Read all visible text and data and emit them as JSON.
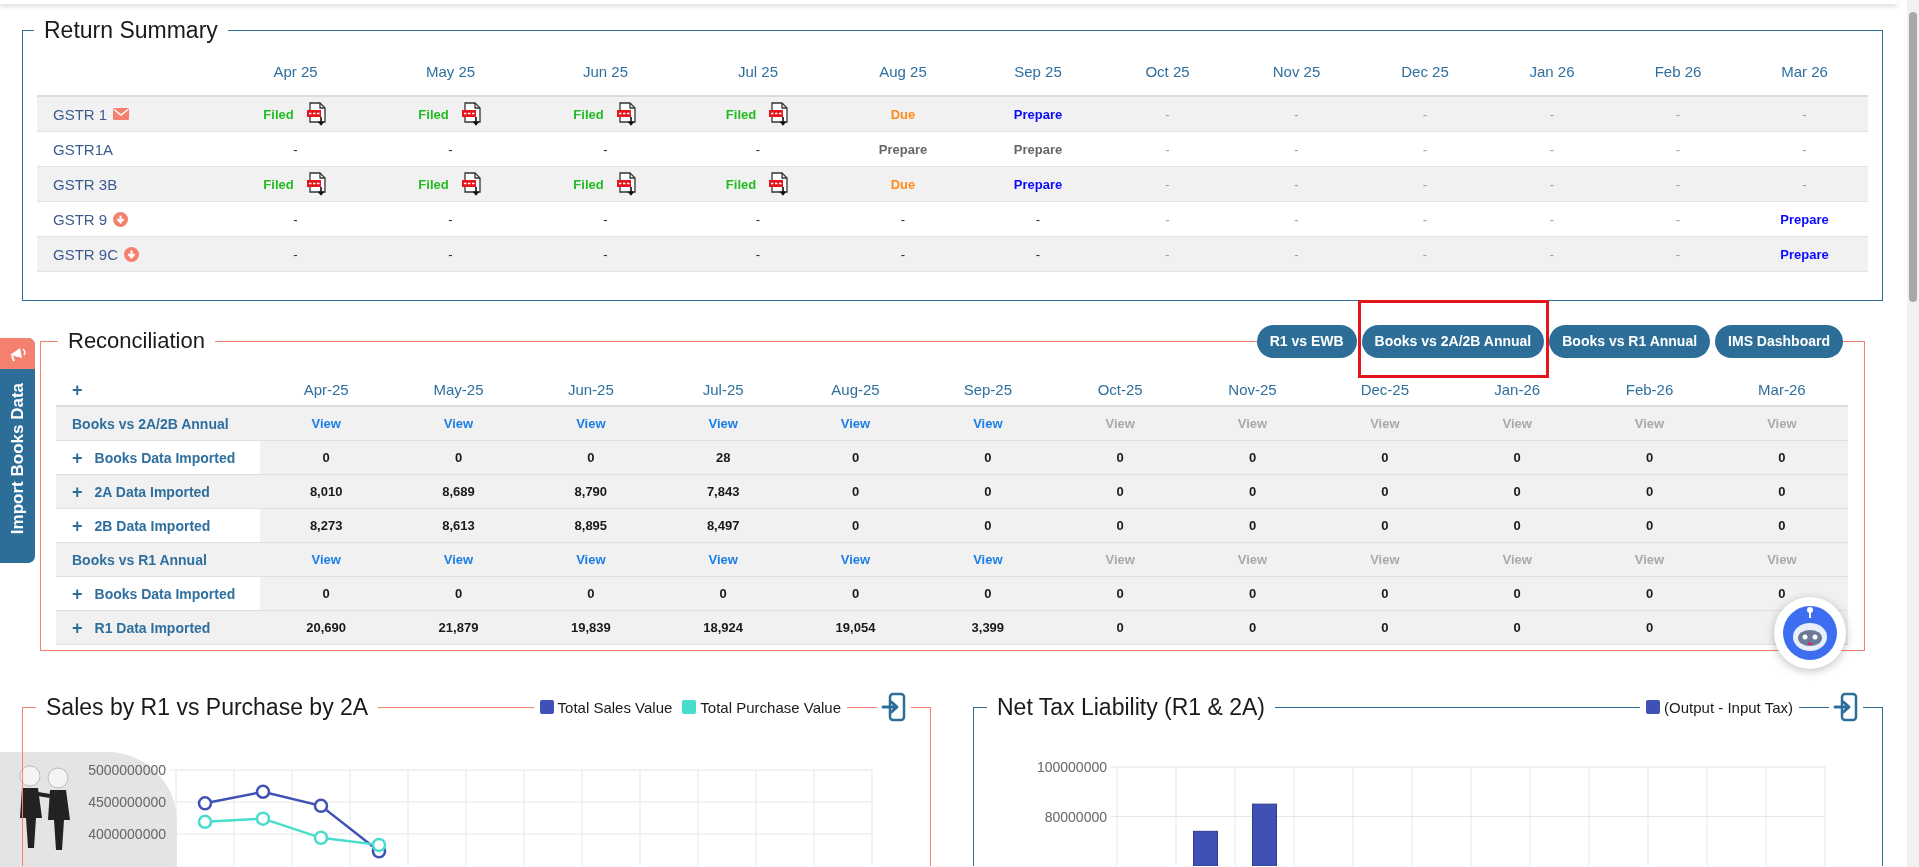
{
  "return_summary": {
    "title": "Return Summary",
    "months": [
      "Apr 25",
      "May 25",
      "Jun 25",
      "Jul 25",
      "Aug 25",
      "Sep 25",
      "Oct 25",
      "Nov 25",
      "Dec 25",
      "Jan 26",
      "Feb 26",
      "Mar 26"
    ],
    "rows": [
      {
        "name": "GSTR 1",
        "kind": "mail",
        "cells": [
          {
            "kind": "filed",
            "text": "Filed",
            "pdf": true
          },
          {
            "kind": "filed",
            "text": "Filed",
            "pdf": true
          },
          {
            "kind": "filed",
            "text": "Filed",
            "pdf": true
          },
          {
            "kind": "filed",
            "text": "Filed",
            "pdf": true
          },
          {
            "kind": "due",
            "text": "Due"
          },
          {
            "kind": "prepare",
            "text": "Prepare"
          },
          {
            "kind": "future",
            "text": "-"
          },
          {
            "kind": "future",
            "text": "-"
          },
          {
            "kind": "future",
            "text": "-"
          },
          {
            "kind": "future",
            "text": "-"
          },
          {
            "kind": "future",
            "text": "-"
          },
          {
            "kind": "future",
            "text": "-"
          }
        ]
      },
      {
        "name": "GSTR1A",
        "kind": "plain",
        "cells": [
          {
            "kind": "none",
            "text": "-"
          },
          {
            "kind": "none",
            "text": "-"
          },
          {
            "kind": "none",
            "text": "-"
          },
          {
            "kind": "none",
            "text": "-"
          },
          {
            "kind": "inactive",
            "text": "Prepare"
          },
          {
            "kind": "inactive",
            "text": "Prepare"
          },
          {
            "kind": "future",
            "text": "-"
          },
          {
            "kind": "future",
            "text": "-"
          },
          {
            "kind": "future",
            "text": "-"
          },
          {
            "kind": "future",
            "text": "-"
          },
          {
            "kind": "future",
            "text": "-"
          },
          {
            "kind": "future",
            "text": "-"
          }
        ]
      },
      {
        "name": "GSTR 3B",
        "kind": "plain",
        "cells": [
          {
            "kind": "filed",
            "text": "Filed",
            "pdf": true
          },
          {
            "kind": "filed",
            "text": "Filed",
            "pdf": true
          },
          {
            "kind": "filed",
            "text": "Filed",
            "pdf": true
          },
          {
            "kind": "filed",
            "text": "Filed",
            "pdf": true
          },
          {
            "kind": "due",
            "text": "Due"
          },
          {
            "kind": "prepare",
            "text": "Prepare"
          },
          {
            "kind": "future",
            "text": "-"
          },
          {
            "kind": "future",
            "text": "-"
          },
          {
            "kind": "future",
            "text": "-"
          },
          {
            "kind": "future",
            "text": "-"
          },
          {
            "kind": "future",
            "text": "-"
          },
          {
            "kind": "future",
            "text": "-"
          }
        ]
      },
      {
        "name": "GSTR 9",
        "kind": "download",
        "cells": [
          {
            "kind": "none",
            "text": "-"
          },
          {
            "kind": "none",
            "text": "-"
          },
          {
            "kind": "none",
            "text": "-"
          },
          {
            "kind": "none",
            "text": "-"
          },
          {
            "kind": "none",
            "text": "-"
          },
          {
            "kind": "none",
            "text": "-"
          },
          {
            "kind": "future",
            "text": "-"
          },
          {
            "kind": "future",
            "text": "-"
          },
          {
            "kind": "future",
            "text": "-"
          },
          {
            "kind": "future",
            "text": "-"
          },
          {
            "kind": "future",
            "text": "-"
          },
          {
            "kind": "prepare",
            "text": "Prepare"
          }
        ]
      },
      {
        "name": "GSTR 9C",
        "kind": "download",
        "cells": [
          {
            "kind": "none",
            "text": "-"
          },
          {
            "kind": "none",
            "text": "-"
          },
          {
            "kind": "none",
            "text": "-"
          },
          {
            "kind": "none",
            "text": "-"
          },
          {
            "kind": "none",
            "text": "-"
          },
          {
            "kind": "none",
            "text": "-"
          },
          {
            "kind": "future",
            "text": "-"
          },
          {
            "kind": "future",
            "text": "-"
          },
          {
            "kind": "future",
            "text": "-"
          },
          {
            "kind": "future",
            "text": "-"
          },
          {
            "kind": "future",
            "text": "-"
          },
          {
            "kind": "prepare",
            "text": "Prepare"
          }
        ]
      }
    ]
  },
  "reconciliation": {
    "title": "Reconciliation",
    "buttons": [
      {
        "label": "R1 vs EWB",
        "highlighted": false
      },
      {
        "label": "Books vs 2A/2B Annual",
        "highlighted": true
      },
      {
        "label": "Books vs R1 Annual",
        "highlighted": false
      },
      {
        "label": "IMS Dashboard",
        "highlighted": false
      }
    ],
    "expand": "+",
    "months": [
      "Apr-25",
      "May-25",
      "Jun-25",
      "Jul-25",
      "Aug-25",
      "Sep-25",
      "Oct-25",
      "Nov-25",
      "Dec-25",
      "Jan-26",
      "Feb-26",
      "Mar-26"
    ],
    "rows": [
      {
        "kind": "group",
        "label": "Books vs 2A/2B Annual",
        "cells": [
          {
            "text": "View",
            "disabled": false
          },
          {
            "text": "View",
            "disabled": false
          },
          {
            "text": "View",
            "disabled": false
          },
          {
            "text": "View",
            "disabled": false
          },
          {
            "text": "View",
            "disabled": false
          },
          {
            "text": "View",
            "disabled": false
          },
          {
            "text": "View",
            "disabled": true
          },
          {
            "text": "View",
            "disabled": true
          },
          {
            "text": "View",
            "disabled": true
          },
          {
            "text": "View",
            "disabled": true
          },
          {
            "text": "View",
            "disabled": true
          },
          {
            "text": "View",
            "disabled": true
          }
        ]
      },
      {
        "kind": "data",
        "toggle": "+",
        "label": "Books Data Imported",
        "cells": [
          "0",
          "0",
          "0",
          "28",
          "0",
          "0",
          "0",
          "0",
          "0",
          "0",
          "0",
          "0"
        ]
      },
      {
        "kind": "data",
        "toggle": "+",
        "label": "2A Data Imported",
        "cells": [
          "8,010",
          "8,689",
          "8,790",
          "7,843",
          "0",
          "0",
          "0",
          "0",
          "0",
          "0",
          "0",
          "0"
        ]
      },
      {
        "kind": "data",
        "toggle": "+",
        "label": "2B Data Imported",
        "cells": [
          "8,273",
          "8,613",
          "8,895",
          "8,497",
          "0",
          "0",
          "0",
          "0",
          "0",
          "0",
          "0",
          "0"
        ]
      },
      {
        "kind": "group",
        "label": "Books vs R1 Annual",
        "cells": [
          {
            "text": "View",
            "disabled": false
          },
          {
            "text": "View",
            "disabled": false
          },
          {
            "text": "View",
            "disabled": false
          },
          {
            "text": "View",
            "disabled": false
          },
          {
            "text": "View",
            "disabled": false
          },
          {
            "text": "View",
            "disabled": false
          },
          {
            "text": "View",
            "disabled": true
          },
          {
            "text": "View",
            "disabled": true
          },
          {
            "text": "View",
            "disabled": true
          },
          {
            "text": "View",
            "disabled": true
          },
          {
            "text": "View",
            "disabled": true
          },
          {
            "text": "View",
            "disabled": true
          }
        ]
      },
      {
        "kind": "data",
        "toggle": "+",
        "label": "Books Data Imported",
        "cells": [
          "0",
          "0",
          "0",
          "0",
          "0",
          "0",
          "0",
          "0",
          "0",
          "0",
          "0",
          "0"
        ]
      },
      {
        "kind": "data",
        "toggle": "+",
        "label": "R1 Data Imported",
        "cells": [
          "20,690",
          "21,879",
          "19,839",
          "18,924",
          "19,054",
          "3,399",
          "0",
          "0",
          "0",
          "0",
          "0"
        ]
      }
    ]
  },
  "charts": [
    {
      "title": "Sales by R1 vs Purchase by 2A",
      "chart_data": {
        "type": "line",
        "series": [
          {
            "name": "Total Sales Value",
            "color": "#3f51b5",
            "marker": "circle",
            "values": [
              4480000000,
              4660000000,
              4440000000,
              3730000000,
              null,
              null,
              null,
              null,
              null,
              null,
              null,
              null
            ]
          },
          {
            "name": "Total Purchase Value",
            "color": "#47dccb",
            "marker": "circle",
            "values": [
              4190000000,
              4240000000,
              3940000000,
              3830000000,
              null,
              null,
              null,
              null,
              null,
              null,
              null,
              null
            ]
          }
        ],
        "ylim": [
          3500000000,
          5000000000
        ],
        "yticks": [
          5000000000,
          4500000000,
          4000000000
        ]
      }
    },
    {
      "title": "Net Tax Liability (R1 & 2A)",
      "chart_data": {
        "type": "bar",
        "series": [
          {
            "name": "(Output - Input Tax)",
            "color": "#3f51b5",
            "values": [
              null,
              74000000,
              85000000,
              null,
              null,
              null,
              null,
              null,
              null,
              null,
              null,
              null
            ]
          }
        ],
        "ylim": [
          60000000,
          100000000
        ],
        "yticks": [
          100000000,
          80000000
        ]
      }
    }
  ],
  "import_tab": {
    "label": "Import Books Data"
  }
}
